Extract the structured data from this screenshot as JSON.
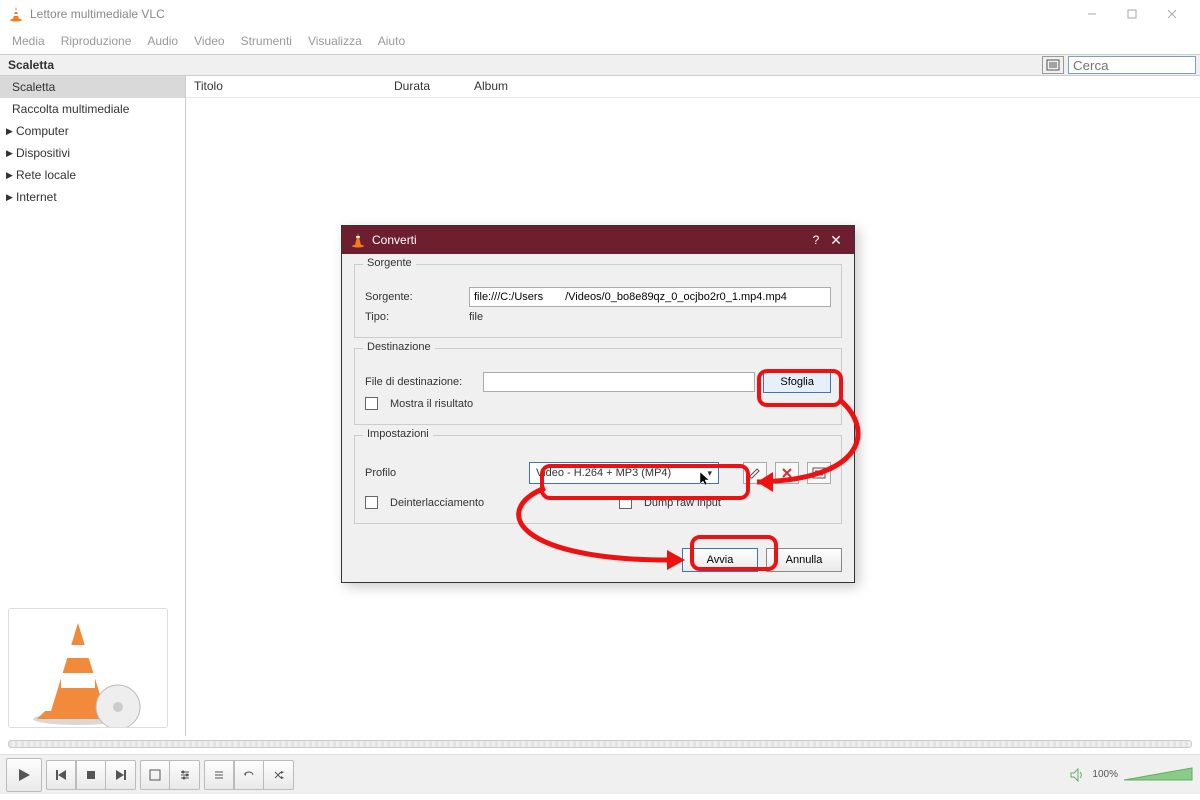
{
  "window": {
    "title": "Lettore multimediale VLC"
  },
  "menubar": [
    "Media",
    "Riproduzione",
    "Audio",
    "Video",
    "Strumenti",
    "Visualizza",
    "Aiuto"
  ],
  "playlist_header": "Scaletta",
  "search_placeholder": "Cerca",
  "sidebar": {
    "items": [
      {
        "label": "Scaletta",
        "selected": true,
        "expandable": false
      },
      {
        "label": "Raccolta multimediale",
        "selected": false,
        "expandable": false
      },
      {
        "label": "Computer",
        "selected": false,
        "expandable": true
      },
      {
        "label": "Dispositivi",
        "selected": false,
        "expandable": true
      },
      {
        "label": "Rete locale",
        "selected": false,
        "expandable": true
      },
      {
        "label": "Internet",
        "selected": false,
        "expandable": true
      }
    ]
  },
  "columns": {
    "title": "Titolo",
    "duration": "Durata",
    "album": "Album"
  },
  "volume_pct": "100%",
  "dialog": {
    "title": "Converti",
    "source_group": "Sorgente",
    "source_label": "Sorgente:",
    "source_value": "file:///C:/Users    /Videos/0_bo8e89qz_0_ocjbo2r0_1.mp4.mp4",
    "type_label": "Tipo:",
    "type_value": "file",
    "dest_group": "Destinazione",
    "dest_label": "File di destinazione:",
    "dest_value": "",
    "browse": "Sfoglia",
    "show_result": "Mostra il risultato",
    "settings_group": "Impostazioni",
    "profile_label": "Profilo",
    "profile_value": "Video - H.264 + MP3 (MP4)",
    "deinterlace": "Deinterlacciamento",
    "dump_raw": "Dump raw input",
    "start": "Avvia",
    "cancel": "Annulla"
  }
}
